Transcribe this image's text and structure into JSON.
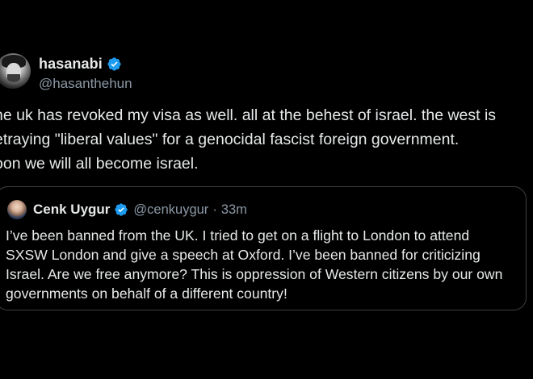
{
  "tweet": {
    "display_name": "hasanabi",
    "handle": "@hasanthehun",
    "verified_color": "#1d9bf0",
    "text": "he uk has revoked my visa as well. all at the behest of israel. the west is\netraying \"liberal values\" for a genocidal fascist foreign government.\noon we will all become israel."
  },
  "quote": {
    "display_name": "Cenk Uygur",
    "handle": "@cenkuygur",
    "separator": "·",
    "time": "33m",
    "text": "I’ve been banned from the UK. I tried to get on a flight to London to attend\nSXSW London and give a speech at Oxford. I’ve been banned for criticizing\nIsrael. Are we free anymore? This is oppression of Western citizens by our own\ngovernments on behalf of a different country!"
  },
  "colors": {
    "background": "#000000",
    "text": "#e7e9ea",
    "secondary_text": "#8b98a5",
    "border": "#3c4043",
    "verified": "#1d9bf0"
  },
  "icons": [
    "avatar",
    "verified-badge-icon",
    "quote-avatar",
    "quote-verified-badge-icon"
  ]
}
